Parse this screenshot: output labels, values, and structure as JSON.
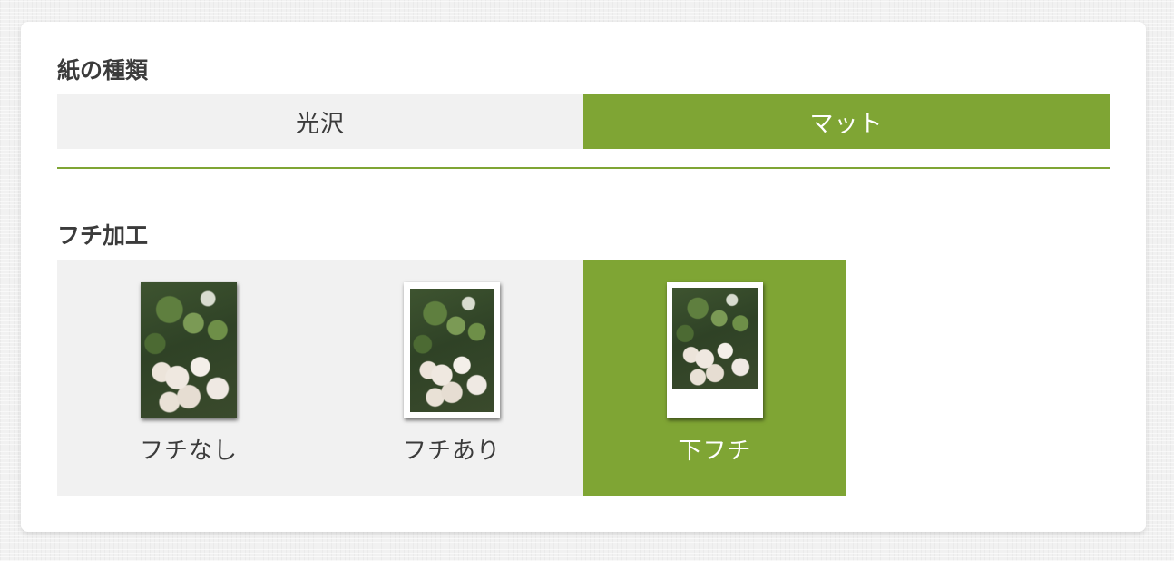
{
  "paper": {
    "title": "紙の種類",
    "options": [
      {
        "label": "光沢",
        "selected": false
      },
      {
        "label": "マット",
        "selected": true
      }
    ]
  },
  "border": {
    "title": "フチ加工",
    "options": [
      {
        "label": "フチなし",
        "selected": false,
        "thumbnail": "photo-no-border"
      },
      {
        "label": "フチあり",
        "selected": false,
        "thumbnail": "photo-with-border"
      },
      {
        "label": "下フチ",
        "selected": true,
        "thumbnail": "photo-bottom-border"
      }
    ]
  },
  "colors": {
    "accent": "#7fa534",
    "unselected_bg": "#f1f1f1",
    "text": "#3b3b3b"
  }
}
